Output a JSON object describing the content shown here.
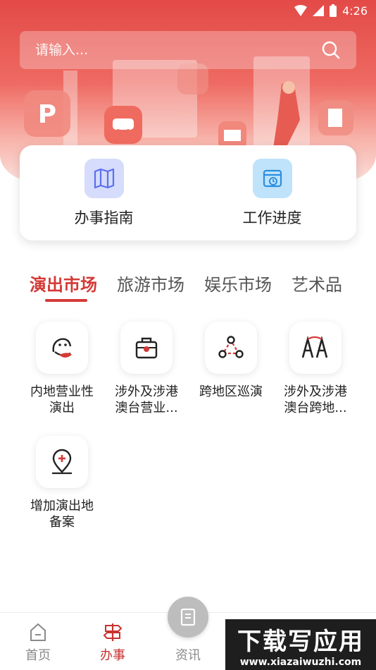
{
  "status_bar": {
    "time": "4:26"
  },
  "search": {
    "placeholder": "请输入..."
  },
  "quick_actions": [
    {
      "label": "办事指南",
      "icon": "map-icon"
    },
    {
      "label": "工作进度",
      "icon": "calendar-clock-icon"
    }
  ],
  "tabs": [
    {
      "label": "演出市场",
      "active": true
    },
    {
      "label": "旅游市场",
      "active": false
    },
    {
      "label": "娱乐市场",
      "active": false
    },
    {
      "label": "艺术品",
      "active": false
    }
  ],
  "services": [
    {
      "label": "内地营业性\n演出",
      "icon": "performance-icon"
    },
    {
      "label": "涉外及涉港\n澳台营业...",
      "icon": "briefcase-icon"
    },
    {
      "label": "跨地区巡演",
      "icon": "route-icon"
    },
    {
      "label": "涉外及涉港\n澳台跨地...",
      "icon": "ha-icon"
    },
    {
      "label": "增加演出地\n备案",
      "icon": "location-add-icon"
    }
  ],
  "bottom_nav": [
    {
      "label": "首页",
      "icon": "home-icon",
      "active": false
    },
    {
      "label": "办事",
      "icon": "signpost-icon",
      "active": true
    },
    {
      "label": "资讯",
      "icon": "news-icon",
      "active": false
    }
  ],
  "watermark": {
    "title": "下载写应用",
    "url": "www.xiazaiwuzhi.com"
  },
  "colors": {
    "accent": "#d33a36",
    "hero": "#e34a47"
  }
}
